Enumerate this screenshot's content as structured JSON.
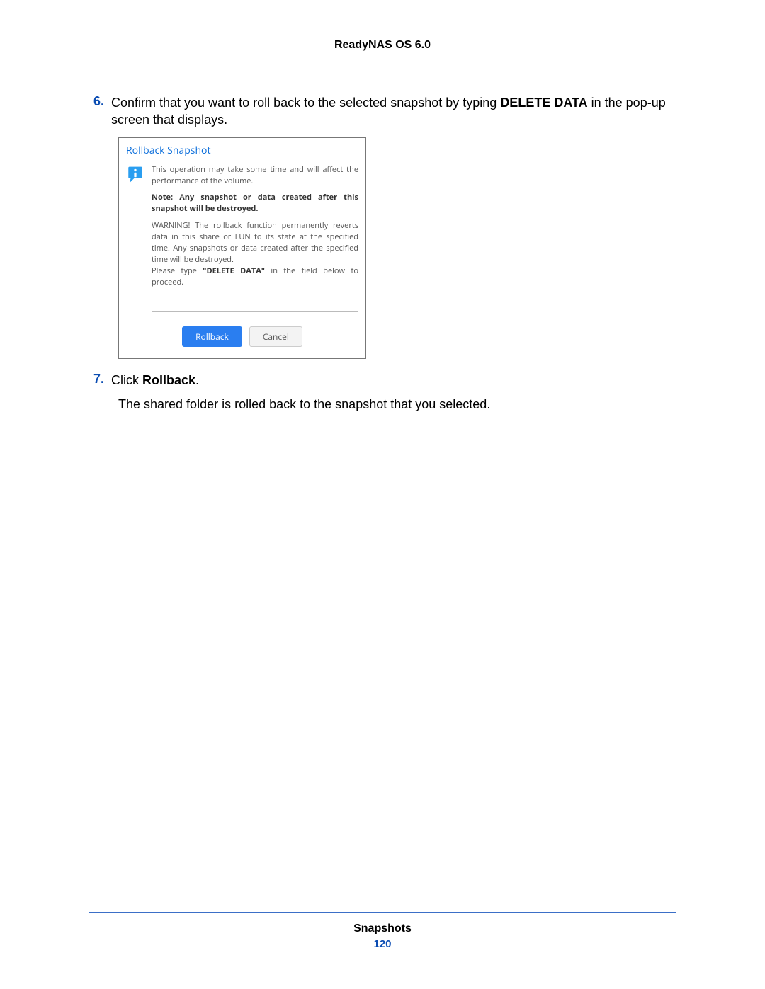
{
  "header": {
    "title": "ReadyNAS OS 6.0"
  },
  "steps": {
    "six": {
      "num": "6.",
      "text_a": "Confirm that you want to roll back to the selected snapshot by typing ",
      "text_bold": "DELETE DATA",
      "text_b": " in the pop-up screen that displays."
    },
    "seven": {
      "num": "7.",
      "text_a": "Click ",
      "text_bold": "Rollback",
      "text_b": "."
    }
  },
  "dialog": {
    "title": "Rollback Snapshot",
    "p1": "This operation may take some time and will affect the performance of the volume.",
    "p2": "Note: Any snapshot or data created after this snapshot will be destroyed.",
    "p3a": "WARNING! The rollback function permanently reverts data in this share or LUN to its state at the specified time. Any snapshots or data created after the specified time will be destroyed.",
    "p3b_a": "Please type ",
    "p3b_bold": "\"DELETE DATA\"",
    "p3b_b": " in the field below to proceed.",
    "buttons": {
      "primary": "Rollback",
      "secondary": "Cancel"
    }
  },
  "followup": "The shared folder is rolled back to the snapshot that you selected.",
  "footer": {
    "section": "Snapshots",
    "page": "120"
  }
}
